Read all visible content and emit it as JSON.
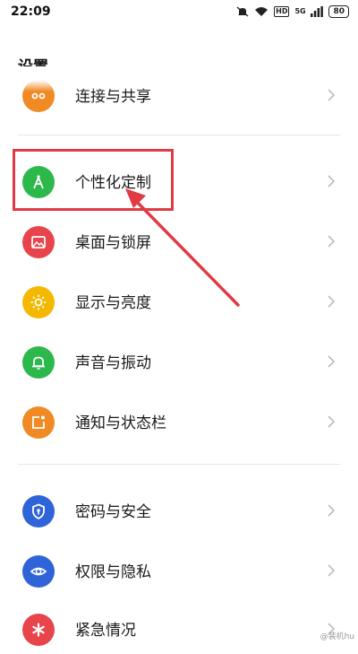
{
  "status_bar": {
    "time": "22:09",
    "hd_badge": "HD",
    "network": "5G",
    "battery": "80"
  },
  "header": {
    "title": "设置"
  },
  "items": [
    {
      "label": "连接与共享",
      "icon": "share-icon",
      "color": "#f08a24"
    },
    {
      "label": "个性化定制",
      "icon": "compass-icon",
      "color": "#2cb84a"
    },
    {
      "label": "桌面与锁屏",
      "icon": "image-icon",
      "color": "#e8444c"
    },
    {
      "label": "显示与亮度",
      "icon": "sun-icon",
      "color": "#f5b800"
    },
    {
      "label": "声音与振动",
      "icon": "bell-icon",
      "color": "#2cb84a"
    },
    {
      "label": "通知与状态栏",
      "icon": "notification-icon",
      "color": "#f08a24"
    },
    {
      "label": "密码与安全",
      "icon": "shield-icon",
      "color": "#2f63d8"
    },
    {
      "label": "权限与隐私",
      "icon": "eye-icon",
      "color": "#2f63d8"
    },
    {
      "label": "紧急情况",
      "icon": "asterisk-icon",
      "color": "#e8444c"
    }
  ],
  "highlight_color": "#e03a45",
  "watermark": "@装机hu"
}
